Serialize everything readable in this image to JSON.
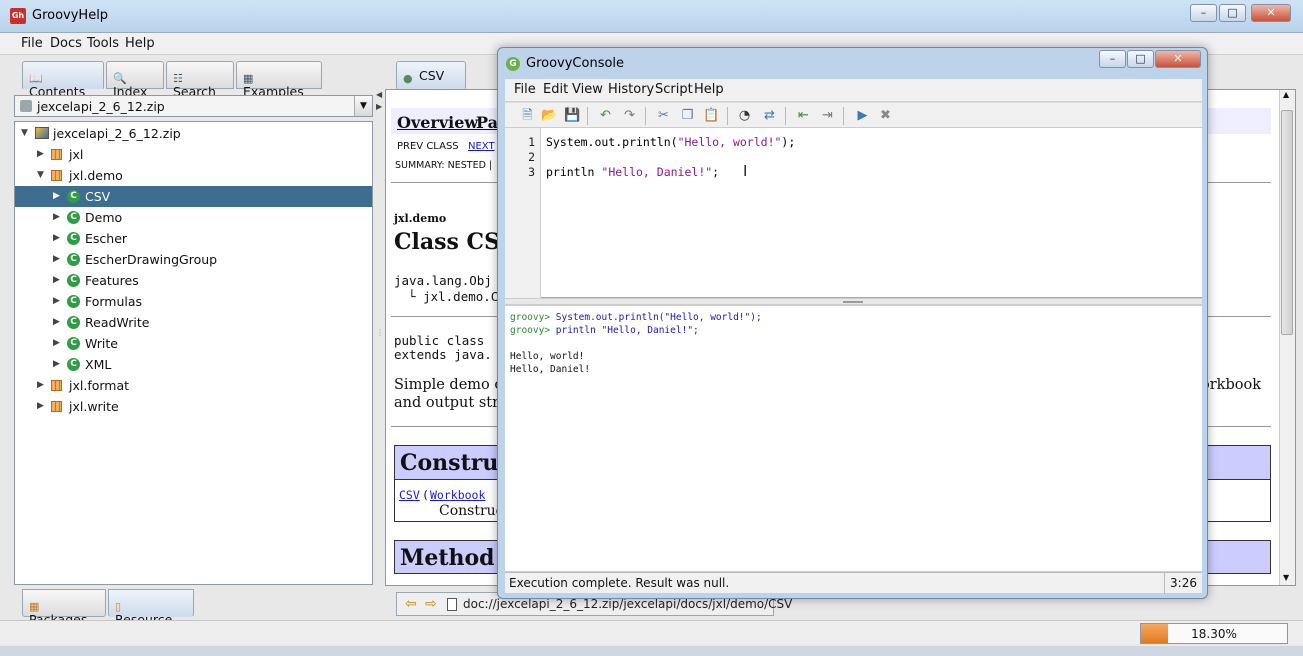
{
  "main_window": {
    "title": "GroovyHelp",
    "menu": [
      "File",
      "Docs",
      "Tools",
      "Help"
    ],
    "window_controls": {
      "minimize": "–",
      "maximize": "□",
      "close": "✕"
    }
  },
  "left_tabs": [
    "Contents",
    "Index",
    "Search",
    "Examples"
  ],
  "zip_combo": {
    "selected": "jexcelapi_2_6_12.zip"
  },
  "tree": [
    {
      "label": "jexcelapi_2_6_12.zip",
      "type": "zip",
      "depth": 0,
      "expanded": true
    },
    {
      "label": "jxl",
      "type": "package",
      "depth": 1,
      "expanded": false
    },
    {
      "label": "jxl.demo",
      "type": "package",
      "depth": 1,
      "expanded": true
    },
    {
      "label": "CSV",
      "type": "class",
      "depth": 2,
      "expanded": false,
      "selected": true
    },
    {
      "label": "Demo",
      "type": "class",
      "depth": 2,
      "expanded": false
    },
    {
      "label": "Escher",
      "type": "class",
      "depth": 2,
      "expanded": false
    },
    {
      "label": "EscherDrawingGroup",
      "type": "class",
      "depth": 2,
      "expanded": false
    },
    {
      "label": "Features",
      "type": "class",
      "depth": 2,
      "expanded": false
    },
    {
      "label": "Formulas",
      "type": "class",
      "depth": 2,
      "expanded": false
    },
    {
      "label": "ReadWrite",
      "type": "class",
      "depth": 2,
      "expanded": false
    },
    {
      "label": "Write",
      "type": "class",
      "depth": 2,
      "expanded": false
    },
    {
      "label": "XML",
      "type": "class",
      "depth": 2,
      "expanded": false
    },
    {
      "label": "jxl.format",
      "type": "package",
      "depth": 1,
      "expanded": false
    },
    {
      "label": "jxl.write",
      "type": "package",
      "depth": 1,
      "expanded": false
    }
  ],
  "left_bottom_tabs": [
    "Packages",
    "Resource"
  ],
  "doc_tab": {
    "label": "CSV",
    "close": "✕"
  },
  "doc": {
    "nav_overview": "Overview",
    "nav_package": "Pa",
    "prev_class": "PREV CLASS",
    "next_class": "NEXT",
    "summary": "SUMMARY: NESTED |",
    "package_name": "jxl.demo",
    "class_title": "Class CSV",
    "hierarchy_1": "java.lang.Obj",
    "hierarchy_2": "jxl.demo.C",
    "decl_1": "public class",
    "decl_2": "extends java.",
    "desc_1": "Simple demo cla",
    "desc_1_right": "orkbook",
    "desc_2": "and output strea",
    "constructor_heading": "Construct",
    "ctor_name": "CSV",
    "ctor_param": "Workbook",
    "ctor_desc": "Construc",
    "method_heading": "Method S"
  },
  "doc_nav": {
    "back": "⇦",
    "forward": "⇨",
    "url": "doc://jexcelapi_2_6_12.zip/jexcelapi/docs/jxl/demo/CSV"
  },
  "progress": {
    "value": 0.183,
    "label": "18.30%"
  },
  "console": {
    "title": "GroovyConsole",
    "menu": [
      "File",
      "Edit",
      "View",
      "History",
      "Script",
      "Help"
    ],
    "toolbar_icons": [
      "new-file-icon",
      "open-icon",
      "save-icon",
      "undo-icon",
      "redo-icon",
      "cut-icon",
      "copy-icon",
      "paste-icon",
      "find-icon",
      "replace-icon",
      "history-prev-icon",
      "history-next-icon",
      "run-icon",
      "interrupt-icon"
    ],
    "editor_lines": [
      {
        "num": "1",
        "code": "System.out.println(",
        "str": "\"Hello, world!\"",
        "tail": ");"
      },
      {
        "num": "2",
        "code": "",
        "str": "",
        "tail": ""
      },
      {
        "num": "3",
        "code": "println ",
        "str": "\"Hello, Daniel!\"",
        "tail": ";"
      }
    ],
    "output": [
      {
        "prompt": "groovy> ",
        "cmd": "System.out.println(\"Hello, world!\");"
      },
      {
        "prompt": "groovy> ",
        "cmd": "println \"Hello, Daniel!\";"
      },
      {
        "prompt": "",
        "cmd": ""
      },
      {
        "prompt": "",
        "text": "Hello, world!"
      },
      {
        "prompt": "",
        "text": "Hello, Daniel!"
      }
    ],
    "status": "Execution complete. Result was null.",
    "cursor_pos": "3:26",
    "window_controls": {
      "minimize": "–",
      "maximize": "□",
      "close": "✕"
    }
  },
  "colors": {
    "tree_selection": "#3d6d8f",
    "console_string": "#8a1a8a",
    "console_prompt": "#2e8b2e",
    "progress_fill": "#e07a20",
    "class_icon": "#2e9d43"
  }
}
